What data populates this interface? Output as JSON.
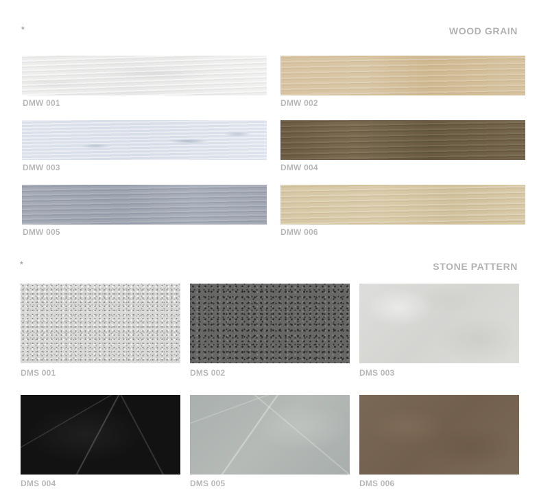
{
  "wood": {
    "marker": "*",
    "title": "WOOD GRAIN",
    "items": [
      {
        "code": "DMW 001"
      },
      {
        "code": "DMW 002"
      },
      {
        "code": "DMW 003"
      },
      {
        "code": "DMW 004"
      },
      {
        "code": "DMW 005"
      },
      {
        "code": "DMW 006"
      }
    ]
  },
  "stone": {
    "marker": "*",
    "title": "STONE PATTERN",
    "items": [
      {
        "code": "DMS 001"
      },
      {
        "code": "DMS 002"
      },
      {
        "code": "DMS 003"
      },
      {
        "code": "DMS 004"
      },
      {
        "code": "DMS 005"
      },
      {
        "code": "DMS 006"
      }
    ]
  },
  "colors": {
    "text_gray": "#b8b8b8",
    "background": "#ffffff"
  }
}
